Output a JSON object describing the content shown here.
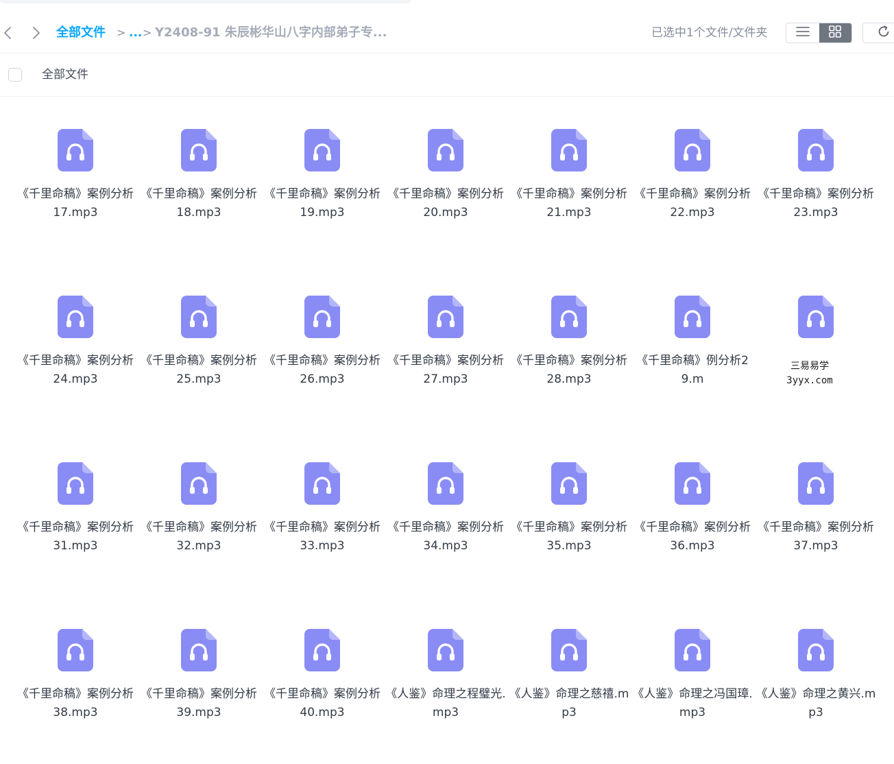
{
  "toolbar": {
    "back_icon": "chevron-left-icon",
    "forward_icon": "chevron-right-icon",
    "breadcrumb": {
      "root": "全部文件",
      "separator": ">",
      "ellipsis": "...",
      "current": "Y2408-91 朱辰彬华山八字内部弟子专..."
    },
    "selection_status": "已选中1个文件/文件夹",
    "view_list_icon": "list-view-icon",
    "view_grid_icon": "grid-view-icon",
    "view_mode": "grid",
    "refresh_icon": "refresh-icon"
  },
  "list_header": {
    "label": "全部文件"
  },
  "colors": {
    "accent": "#06a7ff",
    "audio_icon": "#8a8cf5",
    "toggle_active": "#707582"
  },
  "files": [
    {
      "name": "《千里命稿》案例分析17.mp3",
      "icon": "audio-file-icon"
    },
    {
      "name": "《千里命稿》案例分析18.mp3",
      "icon": "audio-file-icon"
    },
    {
      "name": "《千里命稿》案例分析19.mp3",
      "icon": "audio-file-icon"
    },
    {
      "name": "《千里命稿》案例分析20.mp3",
      "icon": "audio-file-icon"
    },
    {
      "name": "《千里命稿》案例分析21.mp3",
      "icon": "audio-file-icon"
    },
    {
      "name": "《千里命稿》案例分析22.mp3",
      "icon": "audio-file-icon"
    },
    {
      "name": "《千里命稿》案例分析23.mp3",
      "icon": "audio-file-icon"
    },
    {
      "name": "《千里命稿》案例分析24.mp3",
      "icon": "audio-file-icon"
    },
    {
      "name": "《千里命稿》案例分析25.mp3",
      "icon": "audio-file-icon"
    },
    {
      "name": "《千里命稿》案例分析26.mp3",
      "icon": "audio-file-icon"
    },
    {
      "name": "《千里命稿》案例分析27.mp3",
      "icon": "audio-file-icon"
    },
    {
      "name": "《千里命稿》案例分析28.mp3",
      "icon": "audio-file-icon"
    },
    {
      "name": "《千里命稿》例分析29.m",
      "icon": "audio-file-icon"
    },
    {
      "name": "",
      "icon": "audio-file-icon"
    },
    {
      "name": "《千里命稿》案例分析31.mp3",
      "icon": "audio-file-icon"
    },
    {
      "name": "《千里命稿》案例分析32.mp3",
      "icon": "audio-file-icon"
    },
    {
      "name": "《千里命稿》案例分析33.mp3",
      "icon": "audio-file-icon"
    },
    {
      "name": "《千里命稿》案例分析34.mp3",
      "icon": "audio-file-icon"
    },
    {
      "name": "《千里命稿》案例分析35.mp3",
      "icon": "audio-file-icon"
    },
    {
      "name": "《千里命稿》案例分析36.mp3",
      "icon": "audio-file-icon"
    },
    {
      "name": "《千里命稿》案例分析37.mp3",
      "icon": "audio-file-icon"
    },
    {
      "name": "《千里命稿》案例分析38.mp3",
      "icon": "audio-file-icon"
    },
    {
      "name": "《千里命稿》案例分析39.mp3",
      "icon": "audio-file-icon"
    },
    {
      "name": "《千里命稿》案例分析40.mp3",
      "icon": "audio-file-icon"
    },
    {
      "name": "《人鉴》命理之程璧光.mp3",
      "icon": "audio-file-icon"
    },
    {
      "name": "《人鉴》命理之慈禧.mp3",
      "icon": "audio-file-icon"
    },
    {
      "name": "《人鉴》命理之冯国璋.mp3",
      "icon": "audio-file-icon"
    },
    {
      "name": "《人鉴》命理之黄兴.mp3",
      "icon": "audio-file-icon"
    }
  ],
  "watermark": {
    "line1": "三易易学",
    "line2": "3yyx.com"
  }
}
